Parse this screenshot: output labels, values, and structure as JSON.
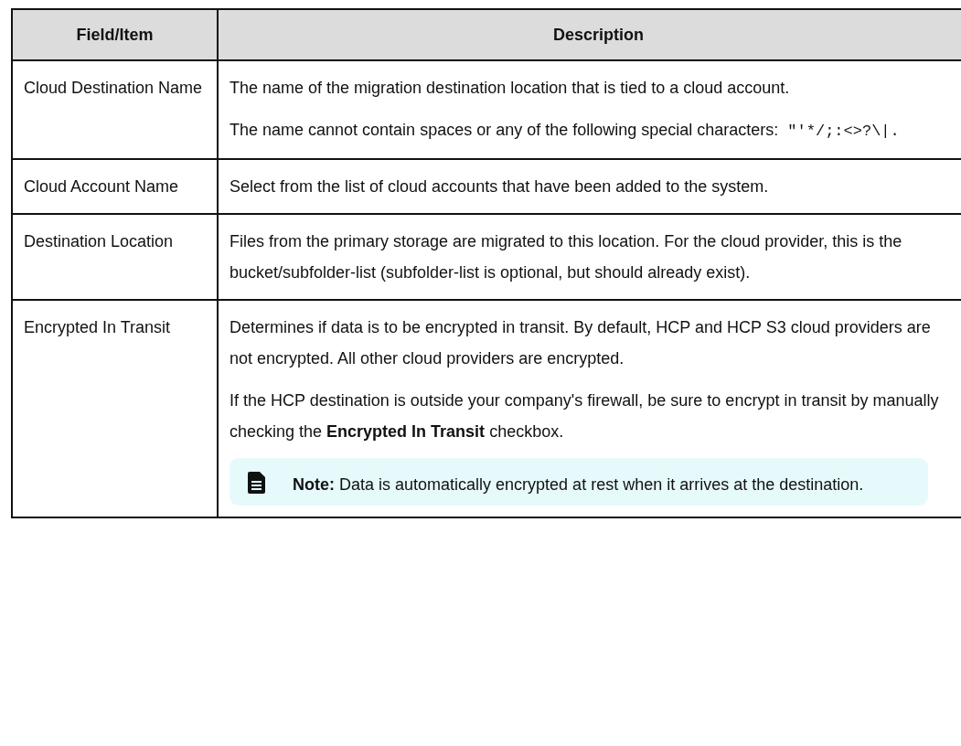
{
  "table": {
    "columns": [
      "Field/Item",
      "Description"
    ],
    "rows": [
      {
        "field": "Cloud Destination Name",
        "description": [
          {
            "kind": "text",
            "text": "The name of the migration destination location that is tied to a cloud account."
          },
          {
            "kind": "text",
            "text": "The name cannot contain spaces or any of the following special characters: ",
            "code": "\"'*/;:<>?\\|."
          }
        ]
      },
      {
        "field": "Cloud Account Name",
        "description": [
          {
            "kind": "text",
            "text": "Select from the list of cloud accounts that have been added to the system."
          }
        ]
      },
      {
        "field": "Destination Location",
        "description": [
          {
            "kind": "text",
            "text": "Files from the primary storage are migrated to this location. For the cloud provider, this is the bucket/subfolder-list (subfolder-list is optional, but should already exist)."
          }
        ]
      },
      {
        "field": "Encrypted In Transit",
        "description": [
          {
            "kind": "text",
            "text": "Determines if data is to be encrypted in transit. By default, HCP and HCP S3 cloud providers are not encrypted. All other cloud providers are encrypted."
          },
          {
            "kind": "text",
            "text": "If the HCP destination is outside your company's firewall, be sure to encrypt in transit by manually checking the **Encrypted In Transit** checkbox."
          },
          {
            "kind": "note",
            "text": "**Note:** Data is automatically encrypted at rest when it arrives at the destination."
          }
        ]
      }
    ]
  }
}
